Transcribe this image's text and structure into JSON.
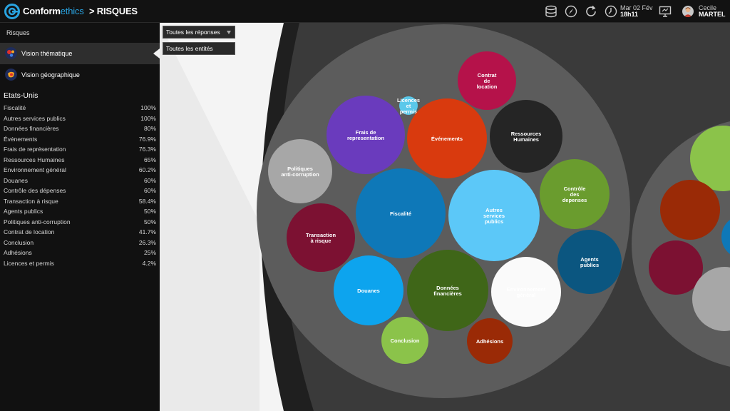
{
  "header": {
    "brand_main": "Conform",
    "brand_accent": "ethics",
    "separator": ">",
    "section": "RISQUES",
    "date_line": "Mar 02 Fév",
    "time_line": "18h11",
    "user_first": "Cecile",
    "user_last": "MARTEL",
    "icons": [
      "database-icon",
      "compass-icon",
      "refresh-icon",
      "clock-icon",
      "monitor-icon"
    ]
  },
  "sidebar": {
    "title": "Risques",
    "items": [
      {
        "label": "Vision thématique",
        "icon": "thematic-vision-icon",
        "active": true
      },
      {
        "label": "Vision géographique",
        "icon": "geographic-vision-icon",
        "active": false
      }
    ],
    "region": "Etats-Unis",
    "risks": [
      {
        "name": "Fiscalité",
        "value": "100%"
      },
      {
        "name": "Autres services publics",
        "value": "100%"
      },
      {
        "name": "Données financières",
        "value": "80%"
      },
      {
        "name": "Événements",
        "value": "76.9%"
      },
      {
        "name": "Frais de représentation",
        "value": "76.3%"
      },
      {
        "name": "Ressources Humaines",
        "value": "65%"
      },
      {
        "name": "Environnement général",
        "value": "60.2%"
      },
      {
        "name": "Douanes",
        "value": "60%"
      },
      {
        "name": "Contrôle des dépenses",
        "value": "60%"
      },
      {
        "name": "Transaction à risque",
        "value": "58.4%"
      },
      {
        "name": "Agents publics",
        "value": "50%"
      },
      {
        "name": "Politiques anti-corruption",
        "value": "50%"
      },
      {
        "name": "Contrat de location",
        "value": "41.7%"
      },
      {
        "name": "Conclusion",
        "value": "26.3%"
      },
      {
        "name": "Adhésions",
        "value": "25%"
      },
      {
        "name": "Licences et permis",
        "value": "4.2%"
      }
    ]
  },
  "filters": {
    "responses": "Toutes les réponses",
    "entities": "Toutes les entités"
  },
  "bubbles": [
    {
      "name": "contrat-de-location",
      "lines": [
        "Contrat",
        "de",
        "location"
      ],
      "color": "#b5124a"
    },
    {
      "name": "licences-et-permis",
      "lines": [
        "Licences",
        "et",
        "permis"
      ],
      "color": "#5bc8ea"
    },
    {
      "name": "frais-de-representation",
      "lines": [
        "Frais de",
        "representation"
      ],
      "color": "#6a3bbd"
    },
    {
      "name": "evenements",
      "lines": [
        "Événements"
      ],
      "color": "#d93a0e"
    },
    {
      "name": "ressources-humaines",
      "lines": [
        "Ressources",
        "Humaines"
      ],
      "color": "#252525"
    },
    {
      "name": "politiques-anti-corruption",
      "lines": [
        "Politiques",
        "anti-corruption"
      ],
      "color": "#a7a7a7"
    },
    {
      "name": "controle-des-depenses",
      "lines": [
        "Contrôle",
        "des",
        "depenses"
      ],
      "color": "#6a9c2e"
    },
    {
      "name": "fiscalite",
      "lines": [
        "Fiscalité"
      ],
      "color": "#0e78b8"
    },
    {
      "name": "autres-services-publics",
      "lines": [
        "Autres",
        "services",
        "publics"
      ],
      "color": "#5cc8f8"
    },
    {
      "name": "transaction-a-risque",
      "lines": [
        "Transaction",
        "à risque"
      ],
      "color": "#7c1132"
    },
    {
      "name": "agents-publics",
      "lines": [
        "Agents",
        "publics"
      ],
      "color": "#0b5680"
    },
    {
      "name": "douanes",
      "lines": [
        "Douanes"
      ],
      "color": "#0da4ee"
    },
    {
      "name": "donnees-financieres",
      "lines": [
        "Données",
        "financières"
      ],
      "color": "#3f6618"
    },
    {
      "name": "environnement-general",
      "lines": [
        "Environnement",
        "général"
      ],
      "color": "#fafafa"
    },
    {
      "name": "conclusion",
      "lines": [
        "Conclusion"
      ],
      "color": "#8bc34a"
    },
    {
      "name": "adhesions",
      "lines": [
        "Adhésions"
      ],
      "color": "#9a2a06"
    }
  ],
  "side_bubbles": [
    {
      "name": "side-bubble-green",
      "color": "#8bc34a"
    },
    {
      "name": "side-bubble-rust",
      "color": "#9a2a06"
    },
    {
      "name": "side-bubble-maroon",
      "color": "#7c1132"
    },
    {
      "name": "side-bubble-grey",
      "color": "#a7a7a7"
    },
    {
      "name": "side-bubble-blue",
      "color": "#0e78b8"
    }
  ]
}
